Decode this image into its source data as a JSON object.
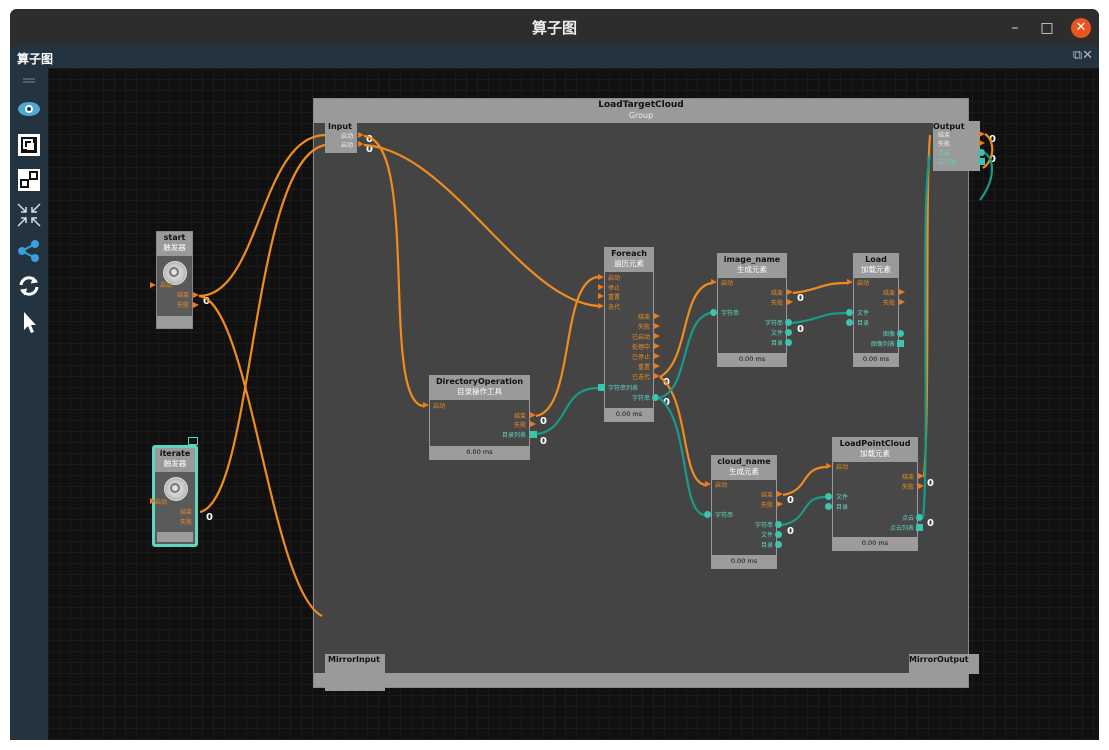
{
  "window": {
    "title": "算子图",
    "panel_title": "算子图"
  },
  "toolbar": {
    "tools": [
      "eye-icon",
      "fit-view-icon",
      "layout-icon",
      "collapse-icon",
      "share-icon",
      "refresh-icon",
      "pointer-icon"
    ]
  },
  "group": {
    "title": "LoadTargetCloud",
    "subtitle": "Group",
    "input": {
      "title": "Input",
      "ports": [
        "启动",
        "启动"
      ]
    },
    "output": {
      "title": "Output",
      "ports": [
        "结束",
        "失败",
        "点云",
        "立方体"
      ]
    },
    "mirror_input": "MirrorInput",
    "mirror_output": "MirrorOutput"
  },
  "nodes": {
    "start": {
      "title": "start",
      "subtitle": "触发器",
      "in": "启动",
      "out": [
        "结束",
        "失败"
      ]
    },
    "iterate": {
      "title": "iterate",
      "subtitle": "触发器",
      "in": "启动",
      "out": [
        "结束",
        "失败"
      ]
    },
    "directory": {
      "title": "DirectoryOperation",
      "subtitle": "目录操作工具",
      "in": [
        "启动"
      ],
      "out": [
        "结束",
        "失败",
        "目录列表"
      ],
      "time": "0.00 ms"
    },
    "foreach": {
      "title": "Foreach",
      "subtitle": "遍历元素",
      "in": [
        "启动",
        "停止",
        "重置",
        "迭代",
        "字符串列表"
      ],
      "out": [
        "结束",
        "失败",
        "已启动",
        "处理中",
        "已停止",
        "重置",
        "已迭代",
        "字符串"
      ],
      "time": "0.00 ms"
    },
    "image_name": {
      "title": "image_name",
      "subtitle": "生成元素",
      "in": [
        "启动",
        "字符串"
      ],
      "out": [
        "结束",
        "失败",
        "字符串",
        "文件",
        "目录"
      ],
      "time": "0.00 ms"
    },
    "load": {
      "title": "Load",
      "subtitle": "加载元素",
      "in": [
        "启动",
        "文件",
        "目录"
      ],
      "out": [
        "结束",
        "失败",
        "图像",
        "图像列表"
      ],
      "time": "0.00 ms"
    },
    "cloud_name": {
      "title": "cloud_name",
      "subtitle": "生成元素",
      "in": [
        "启动",
        "字符串"
      ],
      "out": [
        "结束",
        "失败",
        "字符串",
        "文件",
        "目录"
      ],
      "time": "0.00 ms"
    },
    "loadpointcloud": {
      "title": "LoadPointCloud",
      "subtitle": "加载元素",
      "in": [
        "启动",
        "文件",
        "目录"
      ],
      "out": [
        "结束",
        "失败",
        "点云",
        "点云列表"
      ],
      "time": "0.00 ms"
    }
  },
  "counters": {
    "zero": "0"
  },
  "colors": {
    "exec_wire": "#f08c1e",
    "data_wire": "#1a9a88",
    "accent_close": "#e95420",
    "selected": "#5fd4c0"
  }
}
